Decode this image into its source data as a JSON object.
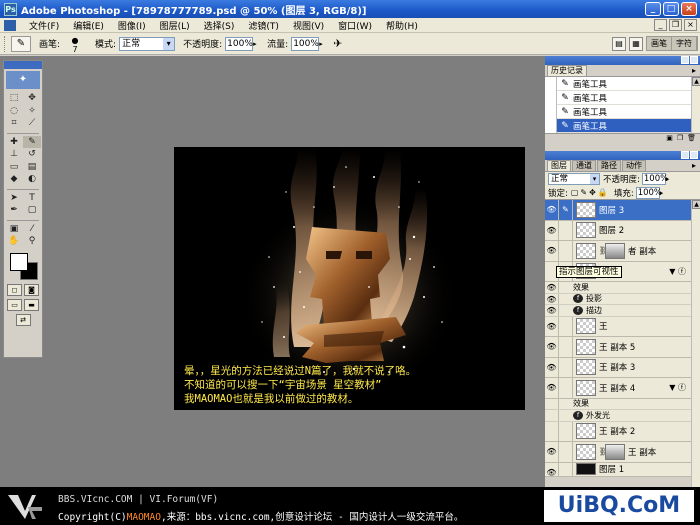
{
  "window": {
    "title": "Adobe Photoshop - [78978777789.psd @ 50% (图层 3, RGB/8)]",
    "ps_mark": "Ps"
  },
  "menu": [
    "文件(F)",
    "编辑(E)",
    "图像(I)",
    "图层(L)",
    "选择(S)",
    "滤镜(T)",
    "视图(V)",
    "窗口(W)",
    "帮助(H)"
  ],
  "options": {
    "brush_label": "画笔:",
    "brush_size": "7",
    "mode_label": "模式:",
    "mode_value": "正常",
    "opacity_label": "不透明度:",
    "opacity_value": "100%",
    "flow_label": "流量:",
    "flow_value": "100%"
  },
  "palette_well": {
    "tabs": [
      "画笔",
      "字符"
    ]
  },
  "canvas": {
    "caption_lines": [
      "晕，，星光的方法已经说过N篇了，我就不说了咯。",
      "不知道的可以搜一下“宇宙场景 星空教材”",
      "我MAOMAO也就是我以前做过的教材。"
    ]
  },
  "history": {
    "tab": "历史记录",
    "items": [
      "画笔工具",
      "画笔工具",
      "画笔工具",
      "画笔工具"
    ]
  },
  "layers": {
    "tabs": [
      "图层",
      "通道",
      "路径",
      "动作"
    ],
    "blend_mode": "正常",
    "opacity_label": "不透明度:",
    "opacity_value": "100%",
    "lock_label": "锁定:",
    "fill_label": "填充:",
    "fill_value": "100%",
    "tooltip": "指示图层可视性",
    "rows": [
      {
        "label": "图层 3"
      },
      {
        "label": "图层 2"
      },
      {
        "label": "者 副本"
      },
      {
        "label": ""
      },
      {
        "label": "效果"
      },
      {
        "label": "投影"
      },
      {
        "label": "描边"
      },
      {
        "label": "王"
      },
      {
        "label": "王 副本 5"
      },
      {
        "label": "王 副本 3"
      },
      {
        "label": "王 副本 4"
      },
      {
        "label": "效果"
      },
      {
        "label": "外发光"
      },
      {
        "label": "王 副本 2"
      },
      {
        "label": "王 副本"
      },
      {
        "label": "图层 1"
      }
    ]
  },
  "footer": {
    "line1_site": "BBS.VIcnc.COM",
    "line1_sep": " | ",
    "line1_forum": "VI.Forum(VF)",
    "line2_a": "Copyright(C)",
    "line2_b": "MAOMAO",
    "line2_c": ",来源：bbs.vicnc.com,创意设计论坛 - 国内设计人一级交流平台。",
    "brand": "UiBQ.CoM"
  }
}
